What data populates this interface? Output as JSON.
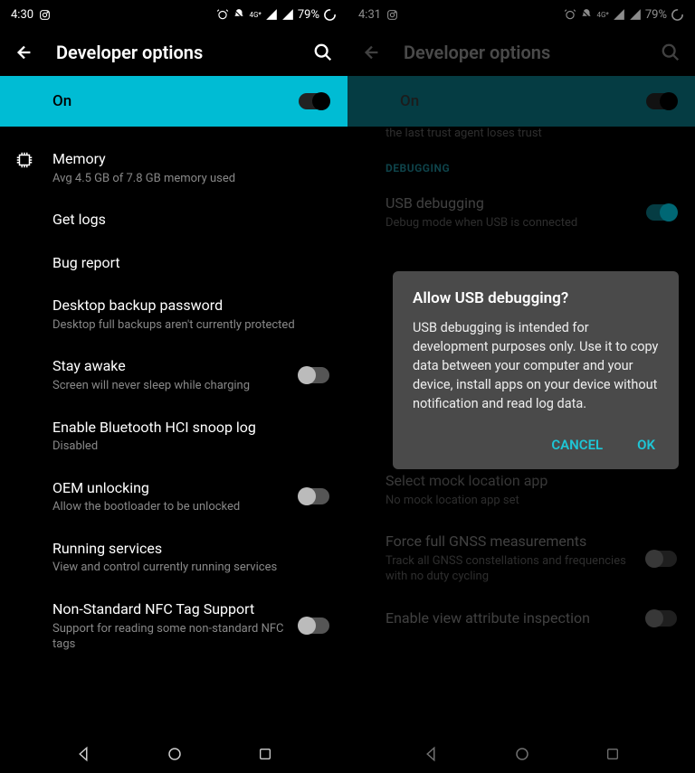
{
  "left": {
    "status": {
      "time": "4:30",
      "battery": "79%"
    },
    "header_title": "Developer options",
    "master": {
      "label": "On"
    },
    "items": [
      {
        "title": "Memory",
        "sub": "Avg 4.5 GB of 7.8 GB memory used"
      },
      {
        "title": "Get logs"
      },
      {
        "title": "Bug report"
      },
      {
        "title": "Desktop backup password",
        "sub": "Desktop full backups aren't currently protected"
      },
      {
        "title": "Stay awake",
        "sub": "Screen will never sleep while charging"
      },
      {
        "title": "Enable Bluetooth HCI snoop log",
        "sub": "Disabled"
      },
      {
        "title": "OEM unlocking",
        "sub": "Allow the bootloader to be unlocked"
      },
      {
        "title": "Running services",
        "sub": "View and control currently running services"
      },
      {
        "title": "Non-Standard NFC Tag Support",
        "sub": "Support for reading some non-standard NFC tags"
      }
    ]
  },
  "right": {
    "status": {
      "time": "4:31",
      "battery": "79%"
    },
    "header_title": "Developer options",
    "master": {
      "label": "On"
    },
    "trunc_top": "the last trust agent loses trust",
    "section": "DEBUGGING",
    "items": [
      {
        "title": "USB debugging",
        "sub": "Debug mode when USB is connected"
      },
      {
        "title": "Select mock location app",
        "sub": "No mock location app set"
      },
      {
        "title": "Force full GNSS measurements",
        "sub": "Track all GNSS constellations and frequencies with no duty cycling"
      },
      {
        "title": "Enable view attribute inspection"
      }
    ],
    "dialog": {
      "title": "Allow USB debugging?",
      "body": "USB debugging is intended for development purposes only. Use it to copy data between your computer and your device, install apps on your device without notification and read log data.",
      "cancel": "CANCEL",
      "ok": "OK"
    }
  }
}
